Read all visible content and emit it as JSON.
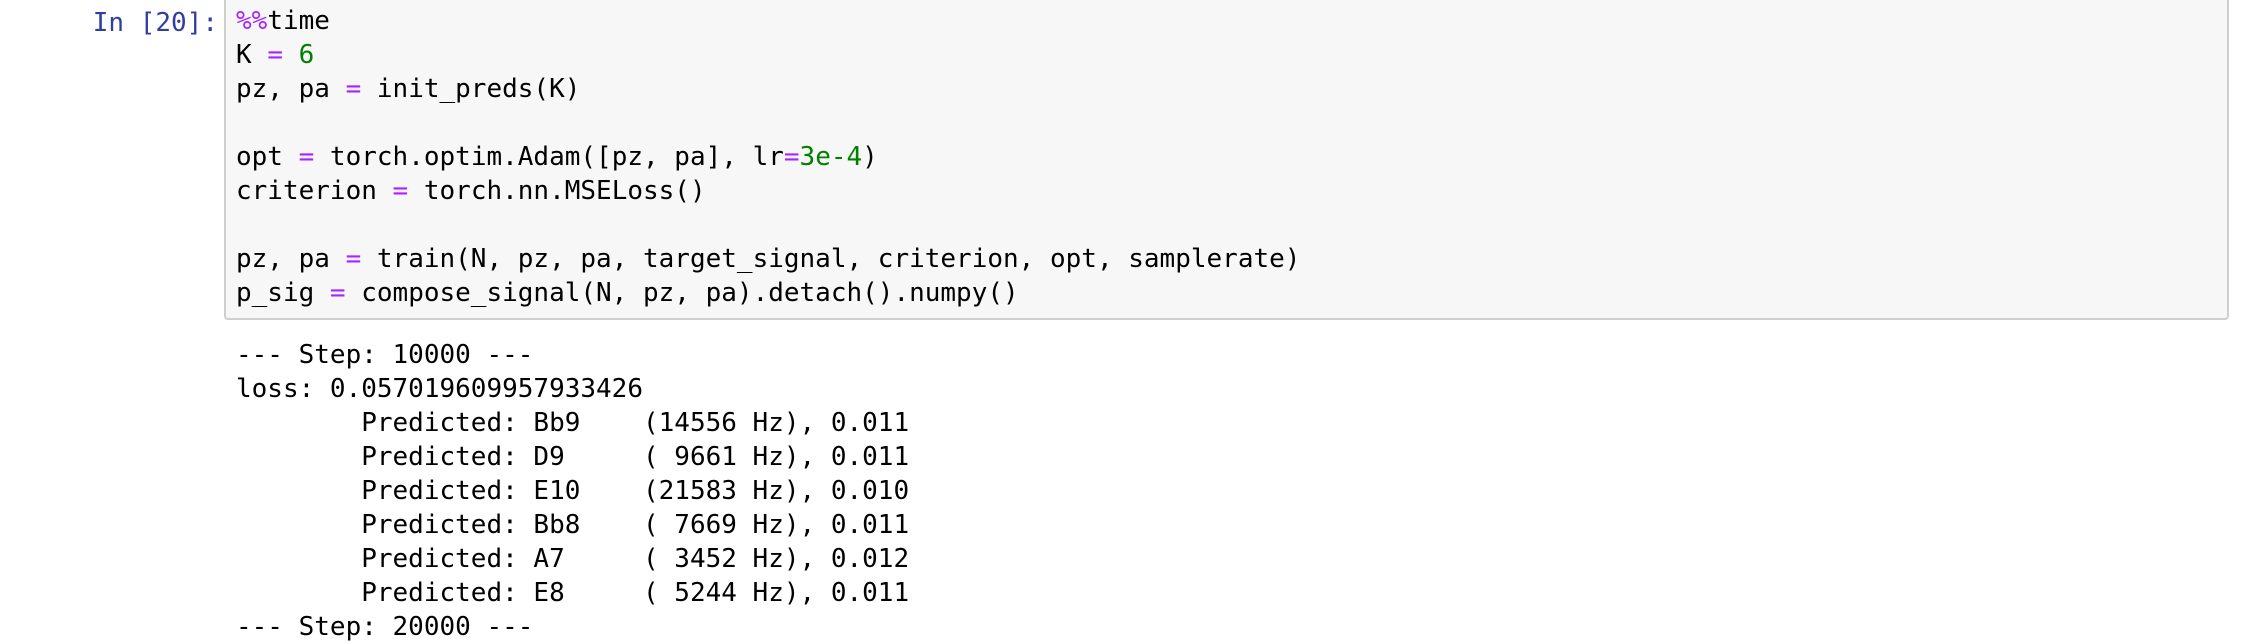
{
  "cell": {
    "prompt": "In [20]:",
    "code_lines": [
      {
        "tokens": [
          {
            "t": "%%",
            "c": "magic"
          },
          {
            "t": "time",
            "c": ""
          }
        ]
      },
      {
        "tokens": [
          {
            "t": "K ",
            "c": ""
          },
          {
            "t": "=",
            "c": "op"
          },
          {
            "t": " ",
            "c": ""
          },
          {
            "t": "6",
            "c": "num"
          }
        ]
      },
      {
        "tokens": [
          {
            "t": "pz, pa ",
            "c": ""
          },
          {
            "t": "=",
            "c": "op"
          },
          {
            "t": " init_preds(K)",
            "c": ""
          }
        ]
      },
      {
        "tokens": []
      },
      {
        "tokens": [
          {
            "t": "opt ",
            "c": ""
          },
          {
            "t": "=",
            "c": "op"
          },
          {
            "t": " torch.optim.Adam([pz, pa], lr",
            "c": ""
          },
          {
            "t": "=",
            "c": "op"
          },
          {
            "t": "3e-4",
            "c": "num"
          },
          {
            "t": ")",
            "c": ""
          }
        ]
      },
      {
        "tokens": [
          {
            "t": "criterion ",
            "c": ""
          },
          {
            "t": "=",
            "c": "op"
          },
          {
            "t": " torch.nn.MSELoss()",
            "c": ""
          }
        ]
      },
      {
        "tokens": []
      },
      {
        "tokens": [
          {
            "t": "pz, pa ",
            "c": ""
          },
          {
            "t": "=",
            "c": "op"
          },
          {
            "t": " train(N, pz, pa, target_signal, criterion, opt, samplerate)",
            "c": ""
          }
        ]
      },
      {
        "tokens": [
          {
            "t": "p_sig ",
            "c": ""
          },
          {
            "t": "=",
            "c": "op"
          },
          {
            "t": " compose_signal(N, pz, pa).detach().numpy()",
            "c": ""
          }
        ]
      }
    ],
    "output_lines": [
      "--- Step: 10000 ---",
      "loss: 0.057019609957933426",
      "\tPredicted: Bb9    (14556 Hz), 0.011",
      "\tPredicted: D9     ( 9661 Hz), 0.011",
      "\tPredicted: E10    (21583 Hz), 0.010",
      "\tPredicted: Bb8    ( 7669 Hz), 0.011",
      "\tPredicted: A7     ( 3452 Hz), 0.012",
      "\tPredicted: E8     ( 5244 Hz), 0.011",
      "--- Step: 20000 ---"
    ]
  },
  "colors": {
    "prompt": "#303f9f",
    "keyword_op": "#aa22ff",
    "number": "#008000",
    "input_bg": "#f7f7f7",
    "input_border": "#cfcfcf"
  }
}
